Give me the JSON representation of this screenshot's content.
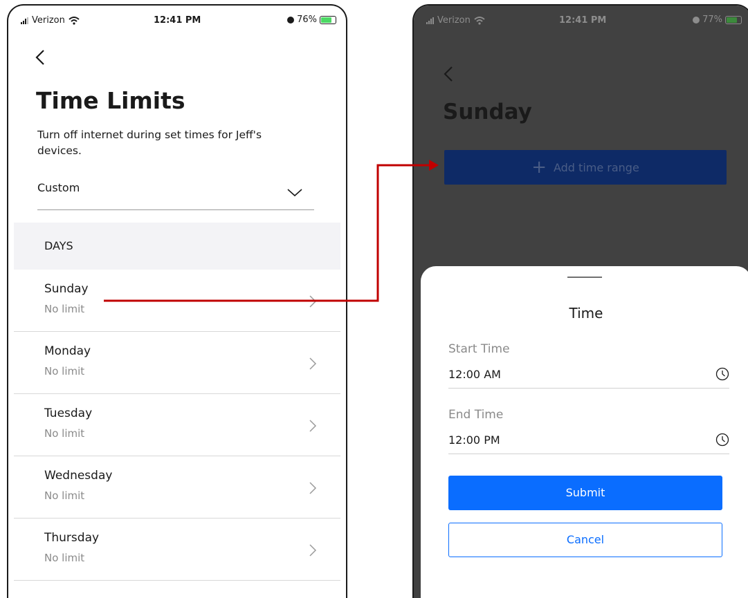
{
  "left_screen": {
    "status": {
      "carrier": "Verizon",
      "time": "12:41 PM",
      "battery": "76%"
    },
    "title": "Time Limits",
    "description": "Turn off internet during set times for Jeff's devices.",
    "schedule_select": {
      "value": "Custom"
    },
    "days_header": "DAYS",
    "days": [
      {
        "name": "Sunday",
        "status": "No limit"
      },
      {
        "name": "Monday",
        "status": "No limit"
      },
      {
        "name": "Tuesday",
        "status": "No limit"
      },
      {
        "name": "Wednesday",
        "status": "No limit"
      },
      {
        "name": "Thursday",
        "status": "No limit"
      }
    ]
  },
  "right_screen": {
    "status": {
      "carrier": "Verizon",
      "time": "12:41 PM",
      "battery": "77%"
    },
    "title": "Sunday",
    "add_range_label": "Add time range",
    "sheet": {
      "title": "Time",
      "start_label": "Start Time",
      "start_value": "12:00 AM",
      "end_label": "End Time",
      "end_value": "12:00 PM",
      "submit_label": "Submit",
      "cancel_label": "Cancel"
    }
  },
  "colors": {
    "primary": "#0a6dff",
    "connector": "#c00000",
    "overlay": "#414141",
    "add_button": "#0e2a66"
  }
}
